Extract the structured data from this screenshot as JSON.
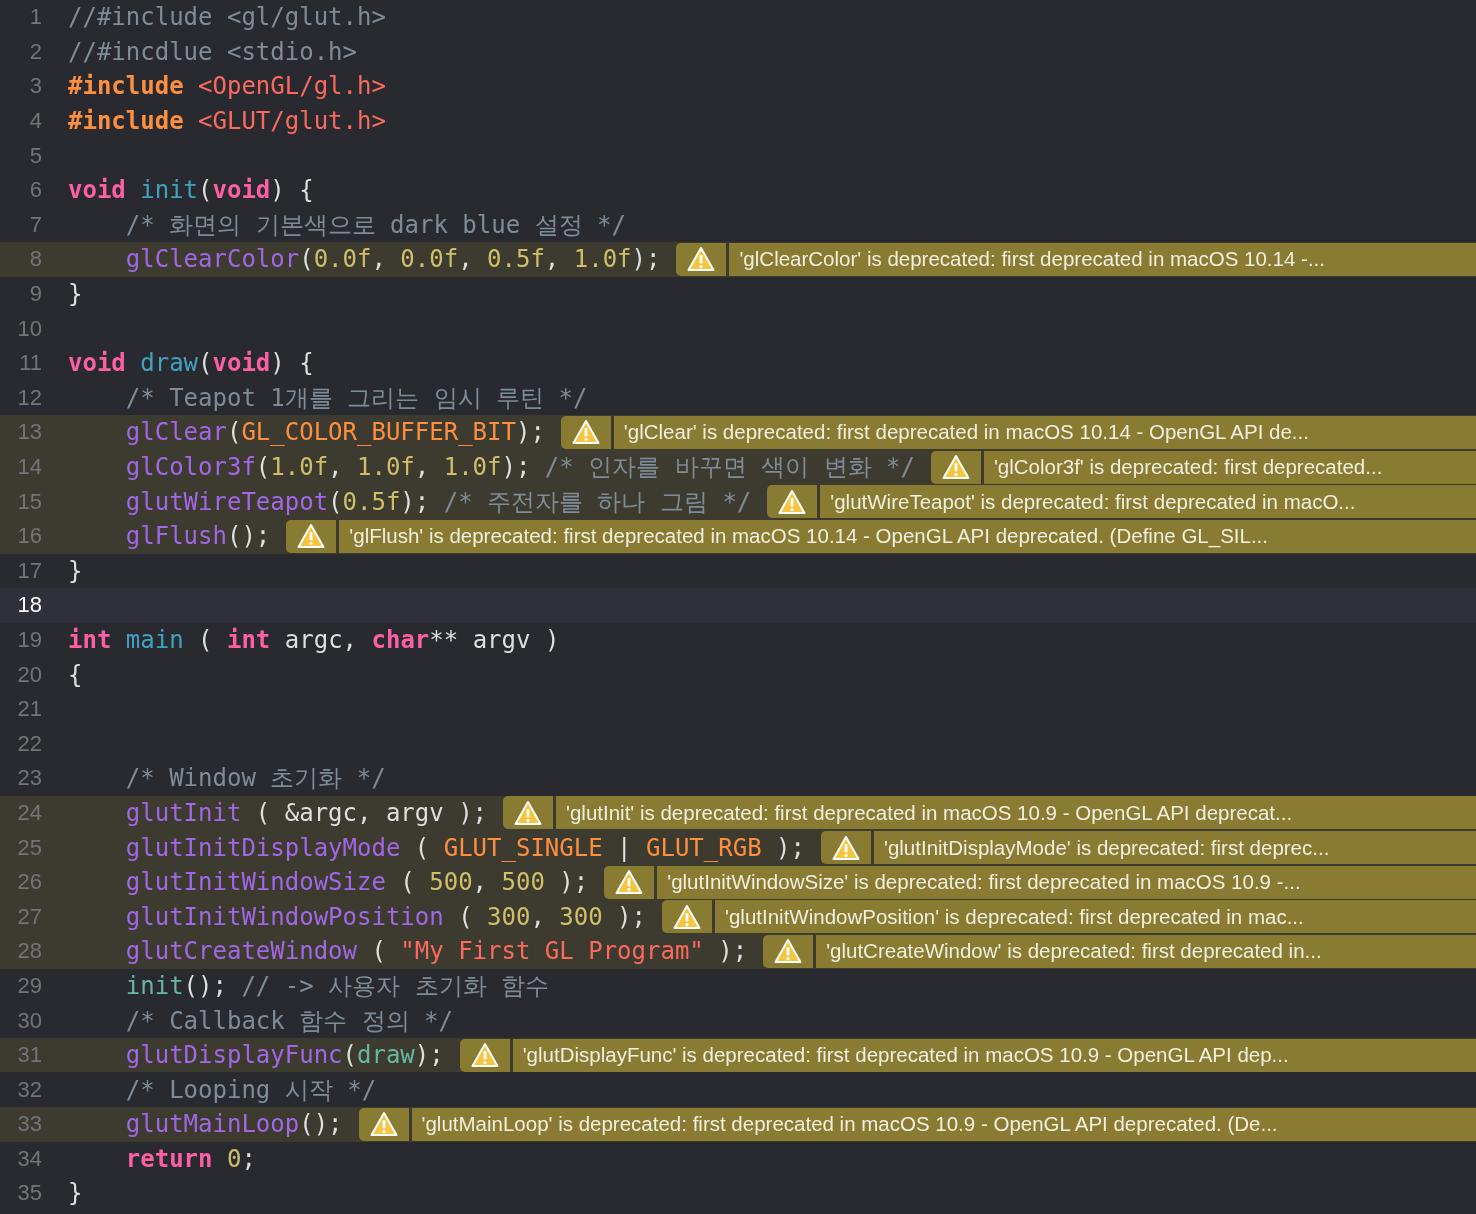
{
  "editor": {
    "lines": [
      {
        "number": "1",
        "current": false,
        "tokens": [
          {
            "kind": "comment",
            "text": "//#include <gl/glut.h>"
          }
        ]
      },
      {
        "number": "2",
        "current": false,
        "tokens": [
          {
            "kind": "comment",
            "text": "//#incdlue <stdio.h>"
          }
        ]
      },
      {
        "number": "3",
        "current": false,
        "tokens": [
          {
            "kind": "preproc",
            "text": "#include"
          },
          {
            "kind": "string",
            "text": " <OpenGL/gl.h>"
          }
        ]
      },
      {
        "number": "4",
        "current": false,
        "tokens": [
          {
            "kind": "preproc",
            "text": "#include"
          },
          {
            "kind": "string",
            "text": " <GLUT/glut.h>"
          }
        ]
      },
      {
        "number": "5",
        "current": false
      },
      {
        "number": "6",
        "current": false,
        "tokens": [
          {
            "kind": "keyword",
            "text": "void"
          },
          {
            "kind": "decl",
            "text": " init"
          },
          {
            "kind": "plain",
            "text": "("
          },
          {
            "kind": "keyword",
            "text": "void"
          },
          {
            "kind": "plain",
            "text": ") {"
          }
        ]
      },
      {
        "number": "7",
        "current": false,
        "tokens": [
          {
            "kind": "comment",
            "text": "    /* 화면의 기본색으로 dark blue 설정 */"
          }
        ]
      },
      {
        "number": "8",
        "current": false,
        "tokens": [
          {
            "kind": "func",
            "text": "    glClearColor"
          },
          {
            "kind": "plain",
            "text": "("
          },
          {
            "kind": "number",
            "text": "0.0f"
          },
          {
            "kind": "plain",
            "text": ", "
          },
          {
            "kind": "number",
            "text": "0.0f"
          },
          {
            "kind": "plain",
            "text": ", "
          },
          {
            "kind": "number",
            "text": "0.5f"
          },
          {
            "kind": "plain",
            "text": ", "
          },
          {
            "kind": "number",
            "text": "1.0f"
          },
          {
            "kind": "plain",
            "text": ");"
          }
        ],
        "warning": "'glClearColor' is deprecated: first deprecated in macOS 10.14 -..."
      },
      {
        "number": "9",
        "current": false,
        "tokens": [
          {
            "kind": "plain",
            "text": "}"
          }
        ]
      },
      {
        "number": "10",
        "current": false
      },
      {
        "number": "11",
        "current": false,
        "tokens": [
          {
            "kind": "keyword",
            "text": "void"
          },
          {
            "kind": "decl",
            "text": " draw"
          },
          {
            "kind": "plain",
            "text": "("
          },
          {
            "kind": "keyword",
            "text": "void"
          },
          {
            "kind": "plain",
            "text": ") {"
          }
        ]
      },
      {
        "number": "12",
        "current": false,
        "tokens": [
          {
            "kind": "comment",
            "text": "    /* Teapot 1개를 그리는 임시 루틴 */"
          }
        ]
      },
      {
        "number": "13",
        "current": false,
        "tokens": [
          {
            "kind": "func",
            "text": "    glClear"
          },
          {
            "kind": "plain",
            "text": "("
          },
          {
            "kind": "macro",
            "text": "GL_COLOR_BUFFER_BIT"
          },
          {
            "kind": "plain",
            "text": ");"
          }
        ],
        "warning": "'glClear' is deprecated: first deprecated in macOS 10.14 - OpenGL API de..."
      },
      {
        "number": "14",
        "current": false,
        "tokens": [
          {
            "kind": "func",
            "text": "    glColor3f"
          },
          {
            "kind": "plain",
            "text": "("
          },
          {
            "kind": "number",
            "text": "1.0f"
          },
          {
            "kind": "plain",
            "text": ", "
          },
          {
            "kind": "number",
            "text": "1.0f"
          },
          {
            "kind": "plain",
            "text": ", "
          },
          {
            "kind": "number",
            "text": "1.0f"
          },
          {
            "kind": "plain",
            "text": ");"
          },
          {
            "kind": "comment",
            "text": " /* 인자를 바꾸면 색이 변화 */"
          }
        ],
        "warning": "'glColor3f' is deprecated: first deprecated..."
      },
      {
        "number": "15",
        "current": false,
        "tokens": [
          {
            "kind": "func",
            "text": "    glutWireTeapot"
          },
          {
            "kind": "plain",
            "text": "("
          },
          {
            "kind": "number",
            "text": "0.5f"
          },
          {
            "kind": "plain",
            "text": ");"
          },
          {
            "kind": "comment",
            "text": " /* 주전자를 하나 그림 */"
          }
        ],
        "warning": "'glutWireTeapot' is deprecated: first deprecated in macO..."
      },
      {
        "number": "16",
        "current": false,
        "tokens": [
          {
            "kind": "func",
            "text": "    glFlush"
          },
          {
            "kind": "plain",
            "text": "();"
          }
        ],
        "warning": "'glFlush' is deprecated: first deprecated in macOS 10.14 - OpenGL API deprecated. (Define GL_SIL..."
      },
      {
        "number": "17",
        "current": false,
        "tokens": [
          {
            "kind": "plain",
            "text": "}"
          }
        ]
      },
      {
        "number": "18",
        "current": true
      },
      {
        "number": "19",
        "current": false,
        "tokens": [
          {
            "kind": "keyword",
            "text": "int"
          },
          {
            "kind": "decl",
            "text": " main"
          },
          {
            "kind": "plain",
            "text": " ( "
          },
          {
            "kind": "keyword",
            "text": "int"
          },
          {
            "kind": "plain",
            "text": " argc, "
          },
          {
            "kind": "keyword",
            "text": "char"
          },
          {
            "kind": "plain",
            "text": "** argv )"
          }
        ]
      },
      {
        "number": "20",
        "current": false,
        "tokens": [
          {
            "kind": "plain",
            "text": "{"
          }
        ]
      },
      {
        "number": "21",
        "current": false
      },
      {
        "number": "22",
        "current": false
      },
      {
        "number": "23",
        "current": false,
        "tokens": [
          {
            "kind": "comment",
            "text": "    /* Window 초기화 */"
          }
        ]
      },
      {
        "number": "24",
        "current": false,
        "tokens": [
          {
            "kind": "func",
            "text": "    glutInit"
          },
          {
            "kind": "plain",
            "text": " ( &argc, argv );"
          }
        ],
        "warning": "'glutInit' is deprecated: first deprecated in macOS 10.9 - OpenGL API deprecat..."
      },
      {
        "number": "25",
        "current": false,
        "tokens": [
          {
            "kind": "func",
            "text": "    glutInitDisplayMode"
          },
          {
            "kind": "plain",
            "text": " ( "
          },
          {
            "kind": "macro",
            "text": "GLUT_SINGLE"
          },
          {
            "kind": "plain",
            "text": " | "
          },
          {
            "kind": "macro",
            "text": "GLUT_RGB"
          },
          {
            "kind": "plain",
            "text": " );"
          }
        ],
        "warning": "'glutInitDisplayMode' is deprecated: first deprec..."
      },
      {
        "number": "26",
        "current": false,
        "tokens": [
          {
            "kind": "func",
            "text": "    glutInitWindowSize"
          },
          {
            "kind": "plain",
            "text": " ( "
          },
          {
            "kind": "number",
            "text": "500"
          },
          {
            "kind": "plain",
            "text": ", "
          },
          {
            "kind": "number",
            "text": "500"
          },
          {
            "kind": "plain",
            "text": " );"
          }
        ],
        "warning": "'glutInitWindowSize' is deprecated: first deprecated in macOS 10.9 -..."
      },
      {
        "number": "27",
        "current": false,
        "tokens": [
          {
            "kind": "func",
            "text": "    glutInitWindowPosition"
          },
          {
            "kind": "plain",
            "text": " ( "
          },
          {
            "kind": "number",
            "text": "300"
          },
          {
            "kind": "plain",
            "text": ", "
          },
          {
            "kind": "number",
            "text": "300"
          },
          {
            "kind": "plain",
            "text": " );"
          }
        ],
        "warning": "'glutInitWindowPosition' is deprecated: first deprecated in mac..."
      },
      {
        "number": "28",
        "current": false,
        "tokens": [
          {
            "kind": "func",
            "text": "    glutCreateWindow"
          },
          {
            "kind": "plain",
            "text": " ( "
          },
          {
            "kind": "string",
            "text": "\"My First GL Program\""
          },
          {
            "kind": "plain",
            "text": " );"
          }
        ],
        "warning": "'glutCreateWindow' is deprecated: first deprecated in..."
      },
      {
        "number": "29",
        "current": false,
        "tokens": [
          {
            "kind": "call",
            "text": "    init"
          },
          {
            "kind": "plain",
            "text": "();"
          },
          {
            "kind": "comment",
            "text": " // -> 사용자 초기화 함수"
          }
        ]
      },
      {
        "number": "30",
        "current": false,
        "tokens": [
          {
            "kind": "comment",
            "text": "    /* Callback 함수 정의 */"
          }
        ]
      },
      {
        "number": "31",
        "current": false,
        "tokens": [
          {
            "kind": "func",
            "text": "    glutDisplayFunc"
          },
          {
            "kind": "plain",
            "text": "("
          },
          {
            "kind": "call",
            "text": "draw"
          },
          {
            "kind": "plain",
            "text": ");"
          }
        ],
        "warning": "'glutDisplayFunc' is deprecated: first deprecated in macOS 10.9 - OpenGL API dep..."
      },
      {
        "number": "32",
        "current": false,
        "tokens": [
          {
            "kind": "comment",
            "text": "    /* Looping 시작 */"
          }
        ]
      },
      {
        "number": "33",
        "current": false,
        "tokens": [
          {
            "kind": "func",
            "text": "    glutMainLoop"
          },
          {
            "kind": "plain",
            "text": "();"
          }
        ],
        "warning": "'glutMainLoop' is deprecated: first deprecated in macOS 10.9 - OpenGL API deprecated. (De..."
      },
      {
        "number": "34",
        "current": false,
        "tokens": [
          {
            "kind": "keyword",
            "text": "    return"
          },
          {
            "kind": "number",
            "text": " 0"
          },
          {
            "kind": "plain",
            "text": ";"
          }
        ]
      },
      {
        "number": "35",
        "current": false,
        "tokens": [
          {
            "kind": "plain",
            "text": "}"
          }
        ]
      }
    ]
  }
}
